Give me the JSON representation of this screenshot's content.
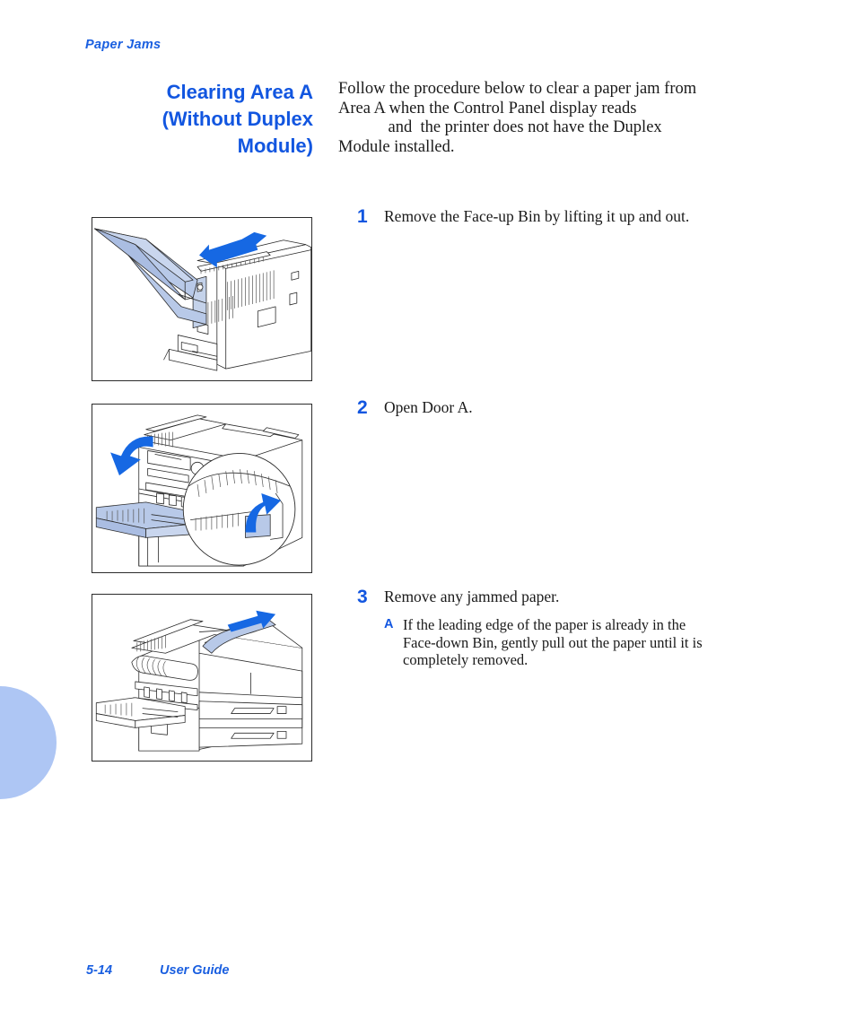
{
  "page": {
    "running_header": "Paper Jams",
    "heading_lines": [
      "Clearing Area A",
      "(Without Duplex",
      "Module)"
    ],
    "intro_lines": [
      "Follow the procedure below to clear a paper jam from",
      "Area A when the Control Panel display reads",
      "            and  the printer does not have the Duplex",
      "Module installed."
    ]
  },
  "steps": [
    {
      "number": "1",
      "text": "Remove the Face-up Bin by lifting it up and out.",
      "figure_name": "face-up-bin-removal-illustration"
    },
    {
      "number": "2",
      "text": "Open Door A.",
      "figure_name": "door-a-open-illustration"
    },
    {
      "number": "3",
      "text": "Remove any jammed paper.",
      "figure_name": "jammed-paper-removal-illustration",
      "substeps": [
        {
          "letter": "A",
          "lines": [
            "If the leading edge of the paper is already in the",
            "Face-down Bin, gently pull out the paper until it is",
            "completely removed."
          ]
        }
      ]
    }
  ],
  "footer": {
    "page_number": "5-14",
    "document_title": "User Guide"
  },
  "colors": {
    "heading_blue": "#1256e0",
    "header_blue": "#1a5fe0",
    "step_number_blue": "#1256e0",
    "thumb_tab_blue": "#aec6f4",
    "illustration_fill_blue": "#b8c9e8",
    "illustration_arrow_blue": "#1668e3",
    "body_text": "#1a1a1a",
    "figure_border": "#2b2b2b"
  }
}
